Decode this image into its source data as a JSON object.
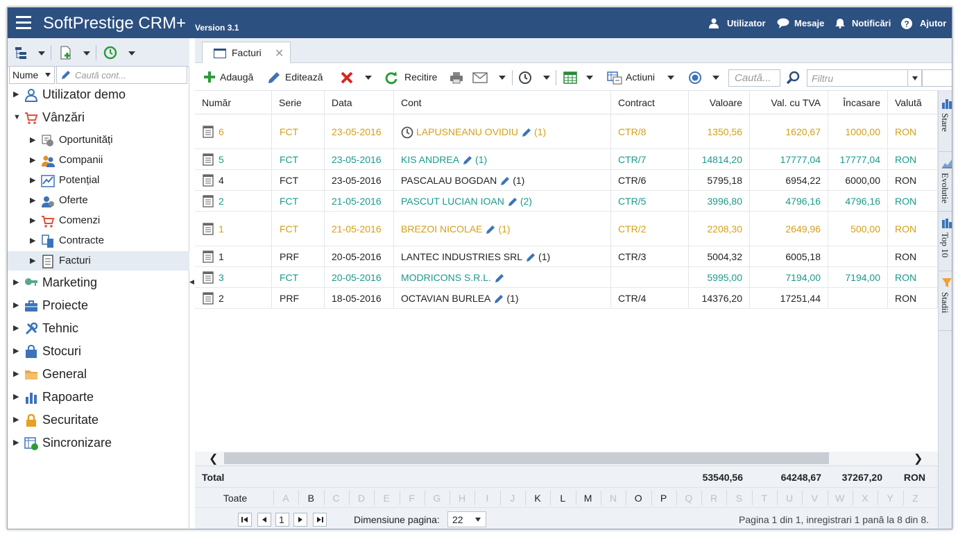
{
  "app": {
    "title": "SoftPrestige CRM+",
    "version": "Version 3.1"
  },
  "topnav": {
    "user": "Utilizator",
    "messages": "Mesaje",
    "notifications": "Notificări",
    "help": "Ajutor"
  },
  "sidebar": {
    "name_selector": "Nume",
    "search_placeholder": "Caută cont...",
    "items": [
      {
        "label": "Utilizator demo",
        "icon": "user-icon"
      },
      {
        "label": "Vânzări",
        "icon": "cart-icon",
        "children": [
          {
            "label": "Oportunități",
            "icon": "opportunity-icon"
          },
          {
            "label": "Companii",
            "icon": "companies-icon"
          },
          {
            "label": "Potențial",
            "icon": "chart-icon"
          },
          {
            "label": "Oferte",
            "icon": "offers-icon"
          },
          {
            "label": "Comenzi",
            "icon": "cart-icon"
          },
          {
            "label": "Contracte",
            "icon": "contracts-icon"
          },
          {
            "label": "Facturi",
            "icon": "invoice-icon"
          }
        ]
      },
      {
        "label": "Marketing",
        "icon": "key-icon"
      },
      {
        "label": "Proiecte",
        "icon": "briefcase-icon"
      },
      {
        "label": "Tehnic",
        "icon": "tools-icon"
      },
      {
        "label": "Stocuri",
        "icon": "bag-icon"
      },
      {
        "label": "General",
        "icon": "folder-icon"
      },
      {
        "label": "Rapoarte",
        "icon": "bar-chart-icon"
      },
      {
        "label": "Securitate",
        "icon": "lock-icon"
      },
      {
        "label": "Sincronizare",
        "icon": "sync-icon"
      }
    ]
  },
  "tab": {
    "label": "Facturi"
  },
  "toolbar": {
    "add": "Adaugă",
    "edit": "Editează",
    "reload": "Recitire",
    "actions": "Actiuni",
    "search_placeholder": "Caută...",
    "filter_placeholder": "Filtru"
  },
  "columns": [
    "Număr",
    "Serie",
    "Data",
    "Cont",
    "Contract",
    "Valoare",
    "Val. cu TVA",
    "Încasare",
    "Valută"
  ],
  "rows": [
    {
      "numar": "6",
      "serie": "FCT",
      "data": "23-05-2016",
      "cont": "LAPUSNEANU OVIDIU",
      "count": "(1)",
      "contract": "CTR/8",
      "valoare": "1350,56",
      "tva": "1620,67",
      "incasare": "1000,00",
      "valuta": "RON",
      "color": "#d4a017",
      "clock": true
    },
    {
      "numar": "5",
      "serie": "FCT",
      "data": "23-05-2016",
      "cont": "KIS ANDREA",
      "count": "(1)",
      "contract": "CTR/7",
      "valoare": "14814,20",
      "tva": "17777,04",
      "incasare": "17777,04",
      "valuta": "RON",
      "color": "#1a9a8a",
      "clock": false
    },
    {
      "numar": "4",
      "serie": "FCT",
      "data": "23-05-2016",
      "cont": "PASCALAU BOGDAN",
      "count": "(1)",
      "contract": "CTR/6",
      "valoare": "5795,18",
      "tva": "6954,22",
      "incasare": "6000,00",
      "valuta": "RON",
      "color": "#222222",
      "clock": false
    },
    {
      "numar": "2",
      "serie": "FCT",
      "data": "21-05-2016",
      "cont": "PASCUT LUCIAN IOAN",
      "count": "(2)",
      "contract": "CTR/5",
      "valoare": "3996,80",
      "tva": "4796,16",
      "incasare": "4796,16",
      "valuta": "RON",
      "color": "#1a9a8a",
      "clock": false
    },
    {
      "numar": "1",
      "serie": "FCT",
      "data": "21-05-2016",
      "cont": "BREZOI NICOLAE",
      "count": "(1)",
      "contract": "CTR/2",
      "valoare": "2208,30",
      "tva": "2649,96",
      "incasare": "500,00",
      "valuta": "RON",
      "color": "#d4a017",
      "clock": false
    },
    {
      "numar": "1",
      "serie": "PRF",
      "data": "20-05-2016",
      "cont": "LANTEC INDUSTRIES SRL",
      "count": "(1)",
      "contract": "CTR/3",
      "valoare": "5004,32",
      "tva": "6005,18",
      "incasare": "",
      "valuta": "RON",
      "color": "#222222",
      "clock": false
    },
    {
      "numar": "3",
      "serie": "FCT",
      "data": "20-05-2016",
      "cont": "MODRICONS S.R.L.",
      "count": "",
      "contract": "",
      "valoare": "5995,00",
      "tva": "7194,00",
      "incasare": "7194,00",
      "valuta": "RON",
      "color": "#1a9a8a",
      "clock": false
    },
    {
      "numar": "2",
      "serie": "PRF",
      "data": "18-05-2016",
      "cont": "OCTAVIAN BURLEA",
      "count": "(1)",
      "contract": "CTR/4",
      "valoare": "14376,20",
      "tva": "17251,44",
      "incasare": "",
      "valuta": "RON",
      "color": "#222222",
      "clock": false
    }
  ],
  "totals": {
    "label": "Total",
    "valoare": "53540,56",
    "tva": "64248,67",
    "incasare": "37267,20",
    "valuta": "RON"
  },
  "alphabet": {
    "all": "Toate",
    "letters": [
      "A",
      "B",
      "C",
      "D",
      "E",
      "F",
      "G",
      "H",
      "I",
      "J",
      "K",
      "L",
      "M",
      "N",
      "O",
      "P",
      "Q",
      "R",
      "S",
      "T",
      "U",
      "V",
      "W",
      "X",
      "Y",
      "Z"
    ],
    "enabled": [
      "B",
      "K",
      "L",
      "M",
      "O",
      "P"
    ]
  },
  "pager": {
    "page": "1",
    "size_label": "Dimensiune pagina:",
    "size": "22",
    "info": "Pagina 1 din 1, inregistrari 1 pană la 8 din 8."
  },
  "side_tabs": [
    "Stare",
    "Evolutie",
    "Top 10",
    "Stadii"
  ],
  "colors": {
    "header": "#2c5080",
    "orange": "#d4a017",
    "teal": "#1a9a8a"
  }
}
